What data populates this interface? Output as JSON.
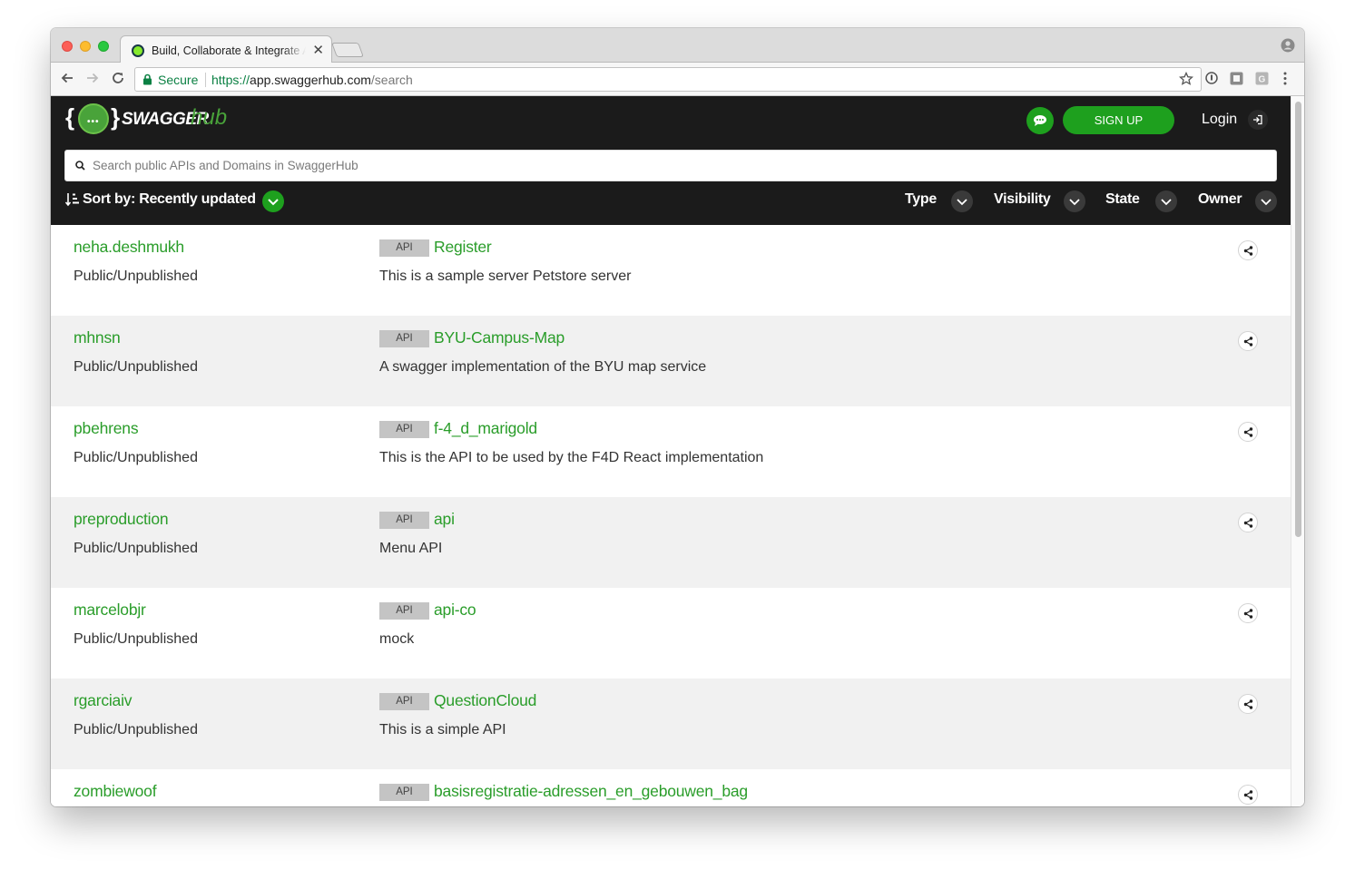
{
  "browser": {
    "tab_title": "Build, Collaborate & Integrate APIs",
    "tab_close": "✕",
    "secure_label": "Secure",
    "url_scheme": "https://",
    "url_host": "app.swaggerhub.com",
    "url_path": "/search"
  },
  "header": {
    "logo_brace_open": "{",
    "logo_brace_close": "}",
    "logo_dots": "•••",
    "logo_swagger": "SWAGGER",
    "logo_hub": "hub",
    "signup_label": "SIGN UP",
    "login_label": "Login"
  },
  "search": {
    "placeholder": "Search public APIs and Domains in SwaggerHub"
  },
  "sort": {
    "label": "Sort by: Recently updated"
  },
  "filters": {
    "type": "Type",
    "visibility": "Visibility",
    "state": "State",
    "owner": "Owner"
  },
  "results": [
    {
      "owner": "neha.deshmukh",
      "visibility": "Public/Unpublished",
      "badge": "API",
      "name": "Register",
      "description": "This is a sample server Petstore server"
    },
    {
      "owner": "mhnsn",
      "visibility": "Public/Unpublished",
      "badge": "API",
      "name": "BYU-Campus-Map",
      "description": "A swagger implementation of the BYU map service"
    },
    {
      "owner": "pbehrens",
      "visibility": "Public/Unpublished",
      "badge": "API",
      "name": "f-4_d_marigold",
      "description": "This is the API to be used by the F4D React implementation"
    },
    {
      "owner": "preproduction",
      "visibility": "Public/Unpublished",
      "badge": "API",
      "name": "api",
      "description": "Menu API"
    },
    {
      "owner": "marcelobjr",
      "visibility": "Public/Unpublished",
      "badge": "API",
      "name": "api-co",
      "description": "mock"
    },
    {
      "owner": "rgarciaiv",
      "visibility": "Public/Unpublished",
      "badge": "API",
      "name": "QuestionCloud",
      "description": "This is a simple API"
    },
    {
      "owner": "zombiewoof",
      "visibility": "",
      "badge": "API",
      "name": "basisregistratie-adressen_en_gebouwen_bag",
      "description": ""
    }
  ],
  "colors": {
    "brand_green": "#1ea01e",
    "link_green": "#2a9d2a",
    "header_bg": "#1b1b1b"
  }
}
